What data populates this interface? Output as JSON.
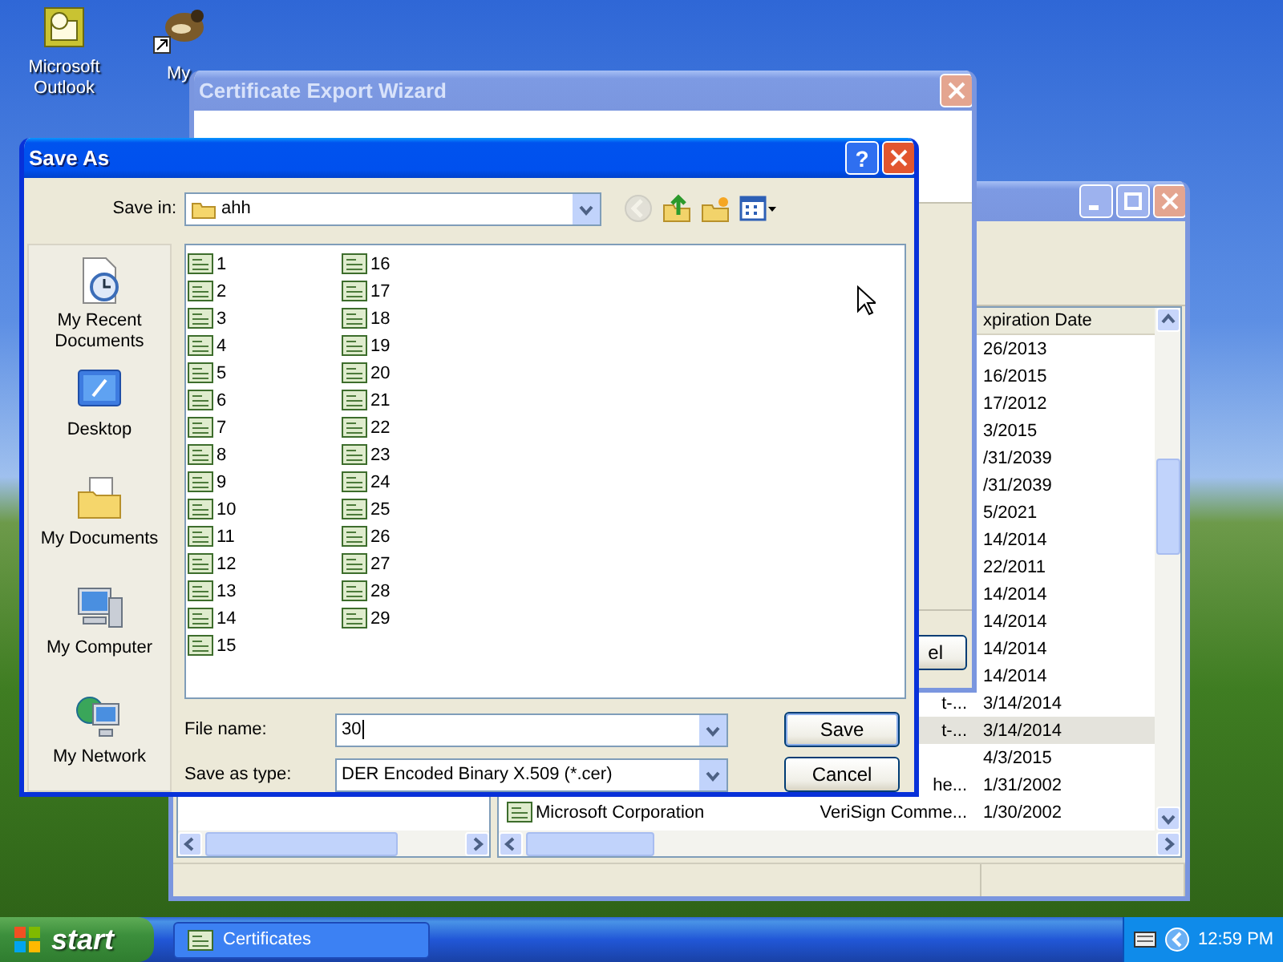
{
  "desktop_icons": [
    {
      "label": "Microsoft Outlook",
      "kind": "outlook"
    },
    {
      "label": "My",
      "kind": "raccoon"
    }
  ],
  "certificates_window": {
    "active": false,
    "expiration_header": "xpiration Date",
    "rows": [
      {
        "expiration": "26/2013",
        "selected": false
      },
      {
        "expiration": "16/2015",
        "selected": false
      },
      {
        "expiration": "17/2012",
        "selected": false
      },
      {
        "expiration": "3/2015",
        "selected": false
      },
      {
        "expiration": "/31/2039",
        "selected": false
      },
      {
        "expiration": "/31/2039",
        "selected": false
      },
      {
        "expiration": "5/2021",
        "selected": false
      },
      {
        "expiration": "14/2014",
        "selected": false
      },
      {
        "expiration": "22/2011",
        "selected": false
      },
      {
        "expiration": "14/2014",
        "selected": false
      },
      {
        "expiration": "14/2014",
        "selected": false
      },
      {
        "expiration": "14/2014",
        "selected": false
      },
      {
        "expiration": "14/2014",
        "selected": false
      },
      {
        "issued_by": "t-...",
        "expiration": "3/14/2014",
        "selected": false
      },
      {
        "issued_by": "t-...",
        "expiration": "3/14/2014",
        "selected": true
      },
      {
        "expiration": "4/3/2015",
        "selected": false
      },
      {
        "issued_by": "he...",
        "expiration": "1/31/2002",
        "selected": false
      },
      {
        "issued_to": "Microsoft Corporation",
        "issued_by": "VeriSign Comme...",
        "expiration": "1/30/2002",
        "selected": false
      }
    ]
  },
  "export_wizard": {
    "title": "Certificate Export Wizard",
    "active": false,
    "cancel_button": "el"
  },
  "save_as": {
    "title": "Save As",
    "active": true,
    "help_button": "?",
    "save_in_label": "Save in:",
    "folder": "ahh",
    "toolbar": [
      {
        "kind": "back",
        "disabled": true
      },
      {
        "kind": "up",
        "disabled": false
      },
      {
        "kind": "new-folder",
        "disabled": false
      },
      {
        "kind": "views",
        "disabled": false
      }
    ],
    "places": [
      {
        "label": "My Recent Documents",
        "kind": "recent"
      },
      {
        "label": "Desktop",
        "kind": "desktop"
      },
      {
        "label": "My Documents",
        "kind": "documents"
      },
      {
        "label": "My Computer",
        "kind": "computer"
      },
      {
        "label": "My Network",
        "kind": "network"
      }
    ],
    "files": [
      "1",
      "2",
      "3",
      "4",
      "5",
      "6",
      "7",
      "8",
      "9",
      "10",
      "11",
      "12",
      "13",
      "14",
      "15",
      "16",
      "17",
      "18",
      "19",
      "20",
      "21",
      "22",
      "23",
      "24",
      "25",
      "26",
      "27",
      "28",
      "29"
    ],
    "file_name_label": "File name:",
    "file_name": "30",
    "type_label": "Save as type:",
    "type_value": "DER Encoded Binary X.509 (*.cer)",
    "buttons": [
      "Save",
      "Cancel"
    ]
  },
  "taskbar": {
    "start": "start",
    "tasks": [
      {
        "label": "Certificates"
      }
    ],
    "clock": "12:59 PM"
  }
}
